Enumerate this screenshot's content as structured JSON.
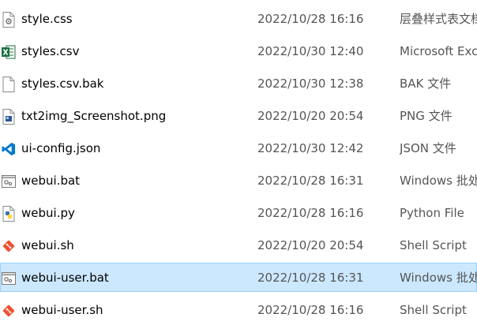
{
  "files": [
    {
      "name": "style.css",
      "date": "2022/10/28 16:16",
      "type": "层叠样式表文档",
      "icon": "css-file-icon",
      "selected": false
    },
    {
      "name": "styles.csv",
      "date": "2022/10/30 12:40",
      "type": "Microsoft Excel",
      "icon": "excel-file-icon",
      "selected": false
    },
    {
      "name": "styles.csv.bak",
      "date": "2022/10/30 12:38",
      "type": "BAK 文件",
      "icon": "blank-file-icon",
      "selected": false
    },
    {
      "name": "txt2img_Screenshot.png",
      "date": "2022/10/20 20:54",
      "type": "PNG 文件",
      "icon": "png-file-icon",
      "selected": false
    },
    {
      "name": "ui-config.json",
      "date": "2022/10/30 12:42",
      "type": "JSON 文件",
      "icon": "vscode-file-icon",
      "selected": false
    },
    {
      "name": "webui.bat",
      "date": "2022/10/28 16:31",
      "type": "Windows 批处理文件",
      "icon": "batch-file-icon",
      "selected": false
    },
    {
      "name": "webui.py",
      "date": "2022/10/28 16:16",
      "type": "Python File",
      "icon": "python-file-icon",
      "selected": false
    },
    {
      "name": "webui.sh",
      "date": "2022/10/20 20:54",
      "type": "Shell Script",
      "icon": "git-shell-file-icon",
      "selected": false
    },
    {
      "name": "webui-user.bat",
      "date": "2022/10/28 16:31",
      "type": "Windows 批处理文件",
      "icon": "batch-file-icon",
      "selected": true
    },
    {
      "name": "webui-user.sh",
      "date": "2022/10/28 16:16",
      "type": "Shell Script",
      "icon": "git-shell-file-icon",
      "selected": false
    }
  ],
  "colors": {
    "selection_bg": "#cce8ff",
    "selection_border": "#99d1ff",
    "excel_green": "#1d6f42",
    "vscode_blue": "#007acc",
    "git_red": "#f05133",
    "python_blue": "#3776ab",
    "python_yellow": "#ffd43b"
  }
}
